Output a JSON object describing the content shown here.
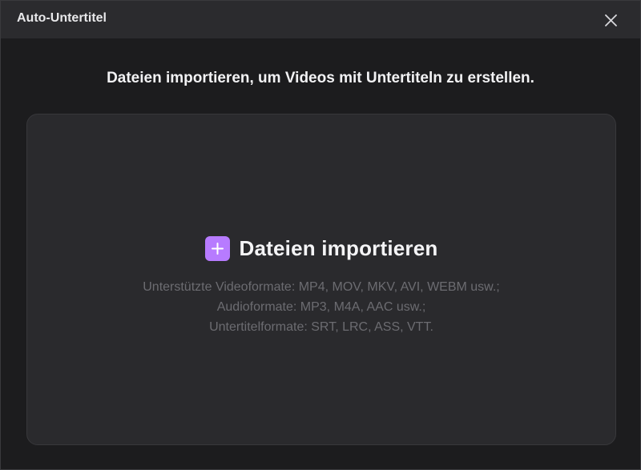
{
  "window": {
    "title": "Auto-Untertitel"
  },
  "headline": "Dateien importieren, um Videos mit Untertiteln zu erstellen.",
  "dropzone": {
    "import_label": "Dateien importieren",
    "formats": [
      "Unterstützte Videoformate: MP4, MOV, MKV, AVI, WEBM usw.;",
      "Audioformate: MP3, M4A, AAC usw.;",
      "Untertitelformate: SRT, LRC, ASS, VTT."
    ]
  },
  "icons": {
    "close": "close-icon",
    "plus": "plus-icon"
  },
  "colors": {
    "accent": "#b77bff",
    "background": "#1c1c1e",
    "titlebar": "#2b2b2e",
    "dropzone": "#2a2a2d",
    "muted_text": "#6c6c71"
  }
}
